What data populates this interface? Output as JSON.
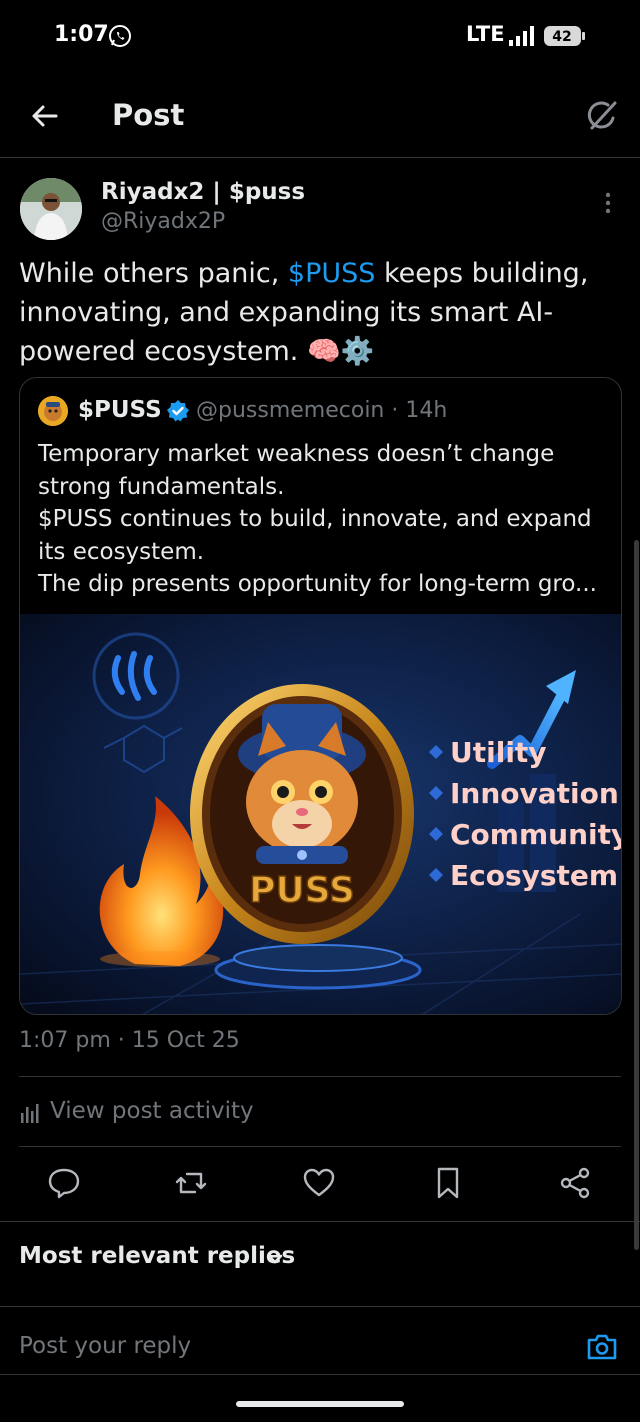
{
  "status_bar": {
    "time": "1:07",
    "network": "LTE",
    "battery": "42"
  },
  "header": {
    "title": "Post"
  },
  "post": {
    "display_name": "Riyadx2 | $puss",
    "handle": "@Riyadx2P",
    "text_before": "While others panic, ",
    "cashtag": "$PUSS",
    "text_after": " keeps building, innovating, and expanding its smart AI-powered ecosystem. 🧠⚙️",
    "timestamp": "1:07 pm · 15 Oct 25"
  },
  "quote": {
    "name": "$PUSS",
    "handle": "@pussmemecoin · 14h",
    "lines": [
      "Temporary market weakness doesn’t change strong fundamentals.",
      "$PUSS continues to build, innovate, and expand its ecosystem.",
      "The dip presents opportunity for long-term gro..."
    ],
    "image": {
      "coin_label": "PUSS",
      "features": [
        "Utility",
        "Innovation",
        "Community",
        "Ecosystem"
      ]
    }
  },
  "activity": {
    "label": "View post activity"
  },
  "replies": {
    "sort_label": "Most relevant replies",
    "placeholder": "Post your reply"
  },
  "colors": {
    "accent": "#1d9bf0",
    "muted": "#71767b",
    "text": "#e7e9ea",
    "border": "#2f3336"
  },
  "icons": {
    "back": "arrow-left-icon",
    "grok": "grok-icon",
    "more": "more-vertical-icon",
    "verified": "verified-badge-icon",
    "reply": "reply-icon",
    "repost": "repost-icon",
    "like": "heart-icon",
    "bookmark": "bookmark-icon",
    "share": "share-icon",
    "camera": "camera-icon",
    "chevron": "chevron-down-icon",
    "activity": "bar-chart-icon"
  }
}
